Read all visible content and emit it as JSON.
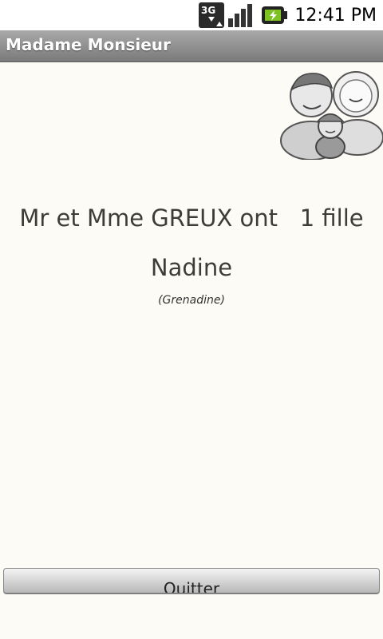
{
  "status_bar": {
    "time": "12:41 PM",
    "network_label": "3G",
    "icons": [
      "3g-data-icon",
      "signal-icon",
      "battery-charging-icon"
    ]
  },
  "app": {
    "title": "Madame Monsieur"
  },
  "content": {
    "headline": "Mr et Mme GREUX ont   1 fille",
    "child_name": "Nadine",
    "nickname": "(Grenadine)"
  },
  "actions": {
    "quit_label": "Quitter"
  },
  "colors": {
    "background": "#fdfbf5",
    "title_bar": "#8f8f8f",
    "text": "#3d3d38"
  }
}
